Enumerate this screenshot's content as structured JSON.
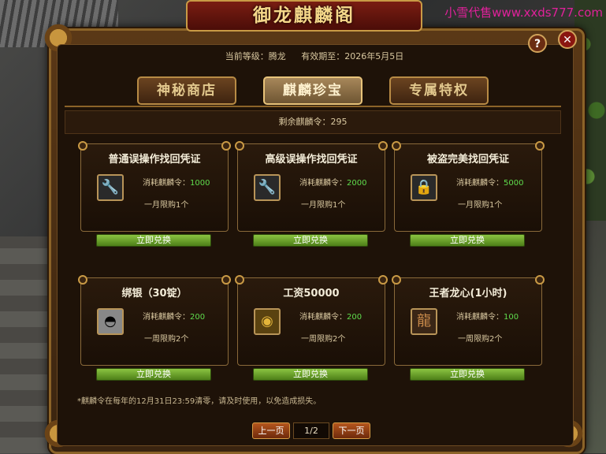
{
  "watermark": "小雪代售www.xxds777.com",
  "window": {
    "title": "御龙麒麟阁",
    "help_symbol": "?",
    "close_symbol": "✕"
  },
  "info": {
    "level": "当前等级：腾龙",
    "valid_until": "有效期至：2026年5月5日"
  },
  "tabs": [
    {
      "label": "神秘商店",
      "active": false
    },
    {
      "label": "麒麟珍宝",
      "active": true
    },
    {
      "label": "专属特权",
      "active": false
    }
  ],
  "remaining": "剩余麒麟令：295",
  "items": [
    {
      "name": "普通误操作找回凭证",
      "cost_label": "消耗麒麟令：",
      "cost": "1000",
      "limit": "一月限购1个",
      "button": "立即兑换",
      "icon": "wrench-icon"
    },
    {
      "name": "高级误操作找回凭证",
      "cost_label": "消耗麒麟令：",
      "cost": "2000",
      "limit": "一月限购1个",
      "button": "立即兑换",
      "icon": "wrench-icon"
    },
    {
      "name": "被盗完美找回凭证",
      "cost_label": "消耗麒麟令：",
      "cost": "5000",
      "limit": "一月限购1个",
      "button": "立即兑换",
      "icon": "padlock-icon"
    },
    {
      "name": "绑银（30锭）",
      "cost_label": "消耗麒麟令：",
      "cost": "200",
      "limit": "一周限购2个",
      "button": "立即兑换",
      "icon": "silver-ingot-icon"
    },
    {
      "name": "工资50000",
      "cost_label": "消耗麒麟令：",
      "cost": "200",
      "limit": "一周限购2个",
      "button": "立即兑换",
      "icon": "gold-coin-icon"
    },
    {
      "name": "王者龙心(1小时)",
      "cost_label": "消耗麒麟令：",
      "cost": "100",
      "limit": "一周限购2个",
      "button": "立即兑换",
      "icon": "dragon-head-icon"
    }
  ],
  "note": "*麒麟令在每年的12月31日23:59清零，请及时使用，以免造成损失。",
  "pager": {
    "prev": "上一页",
    "page": "1/2",
    "next": "下一页"
  }
}
